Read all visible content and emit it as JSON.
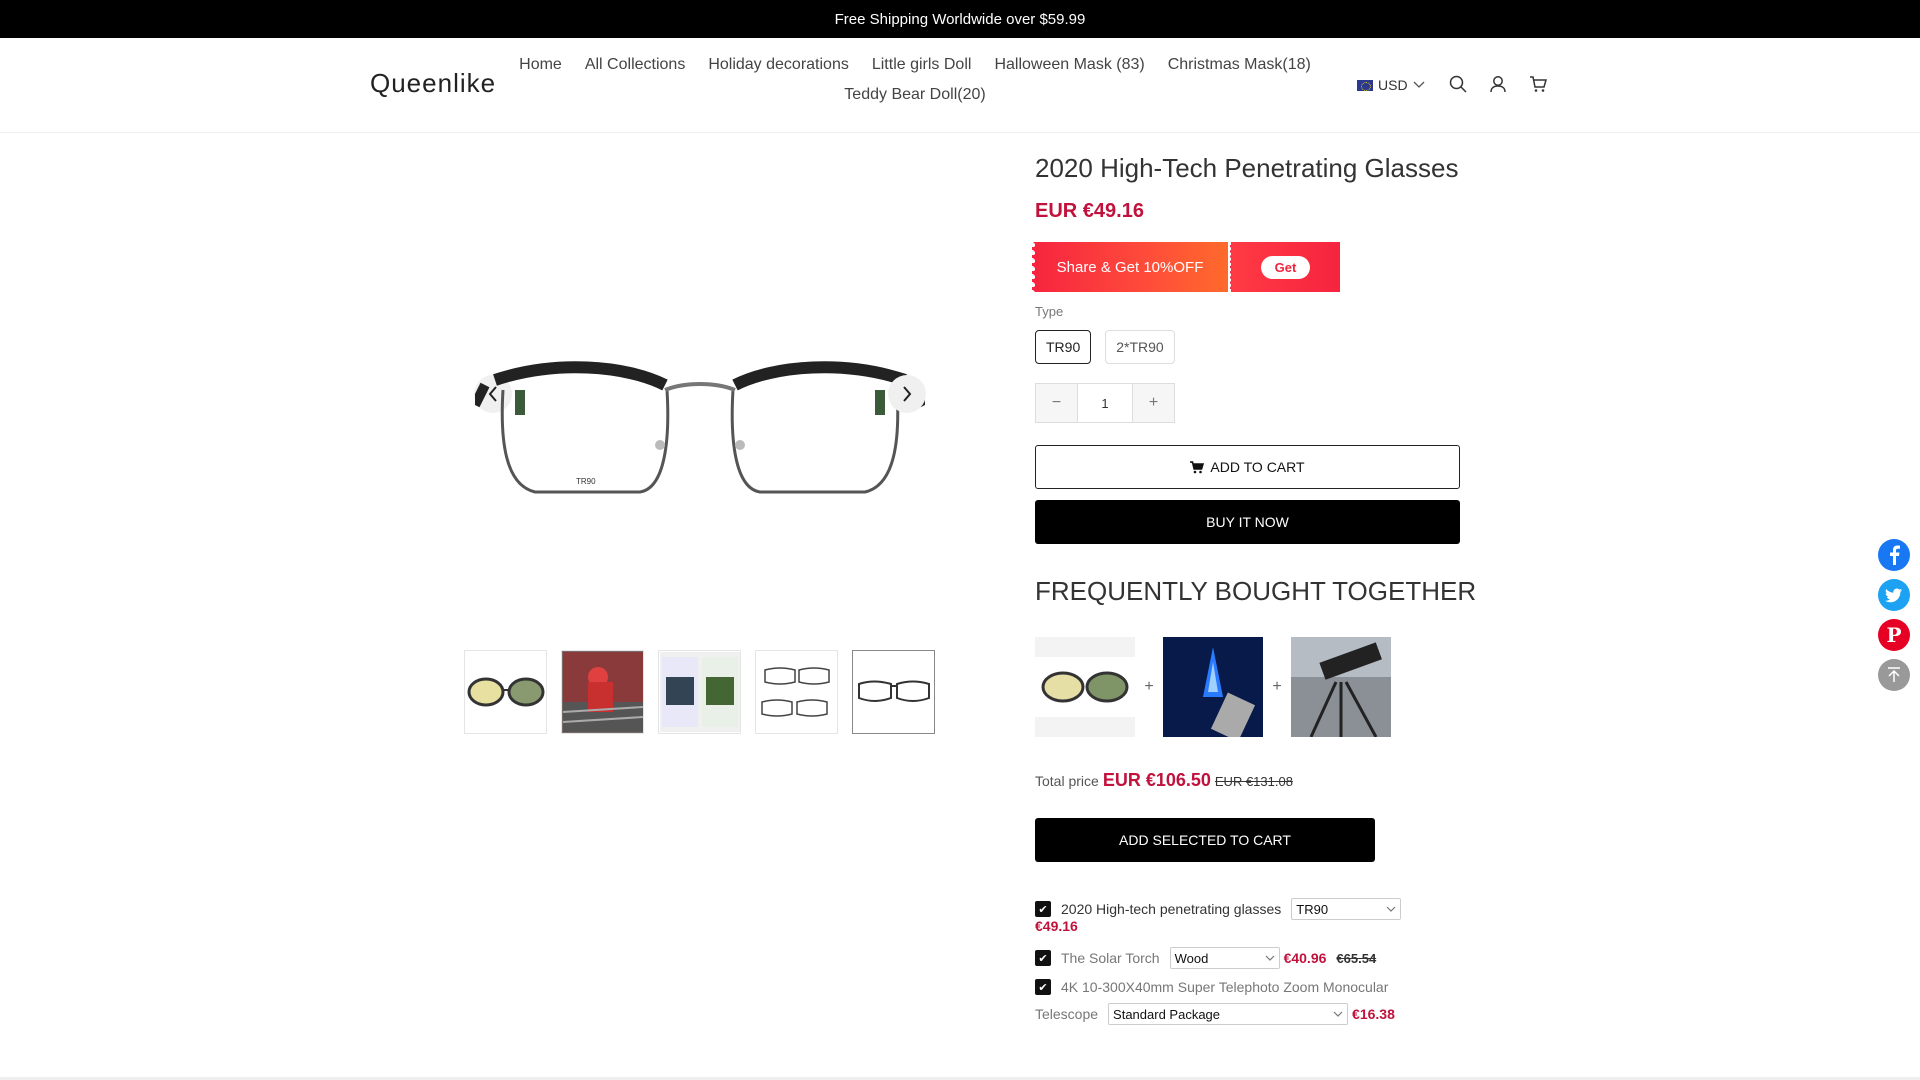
{
  "announcement": "Free Shipping Worldwide over $59.99",
  "header": {
    "logo": "Queenlike",
    "nav": [
      "Home",
      "All Collections",
      "Holiday decorations",
      "Little girls Doll",
      "Halloween Mask (83)",
      "Christmas Mask(18)",
      "Teddy Bear Doll(20)"
    ],
    "currency": "USD",
    "icons": [
      "search-icon",
      "account-icon",
      "cart-icon"
    ]
  },
  "product": {
    "title": "2020 High-Tech Penetrating Glasses",
    "price": "EUR €49.16",
    "share_text": "Share & Get 10%OFF",
    "share_get": "Get",
    "type_label": "Type",
    "options": [
      "TR90",
      "2*TR90"
    ],
    "selected_option": "TR90",
    "quantity": "1",
    "add_to_cart": "ADD TO CART",
    "buy_now": "BUY IT NOW",
    "lens_text": "TR90",
    "thumbnail_count": 5,
    "active_thumbnail": 5
  },
  "fbt": {
    "title": "FREQUENTLY BOUGHT TOGETHER",
    "total_label": "Total price",
    "total_price": "EUR €106.50",
    "total_old": "EUR €131.08",
    "button": "ADD SELECTED TO CART",
    "items": [
      {
        "name": "2020 High-tech penetrating glasses",
        "option": "TR90",
        "price": "€49.16",
        "old": ""
      },
      {
        "name": "The Solar Torch",
        "option": "Wood",
        "price": "€40.96",
        "old": "€65.54"
      },
      {
        "name_line1": "4K 10-300X40mm Super Telephoto Zoom Monocular",
        "name_line2": "Telescope",
        "option": "Standard Package",
        "price": "€16.38",
        "old": ""
      }
    ]
  },
  "social": [
    "facebook-icon",
    "twitter-icon",
    "pinterest-icon",
    "back-to-top-icon"
  ],
  "colors": {
    "accent": "#c0123c",
    "facebook": "#1877f2",
    "twitter": "#1da1f2",
    "pinterest": "#e60023"
  }
}
